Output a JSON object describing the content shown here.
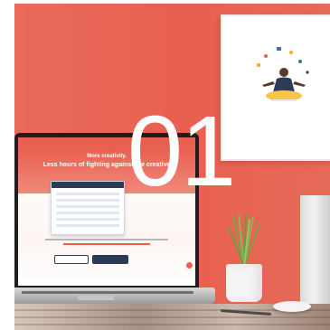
{
  "overlay": {
    "number": "01"
  },
  "laptop_website": {
    "hero_title": "More creativity.",
    "hero_subtitle": "Less hours of fighting against the creative",
    "primary_button_label": "",
    "secondary_button_label": ""
  },
  "poster": {
    "caption": ""
  },
  "colors": {
    "wall": "#e8604f",
    "overlay_text": "#ffffff",
    "website_accent": "#e8604f",
    "website_dark": "#2b3a55",
    "pot": "#f4f4f4"
  }
}
